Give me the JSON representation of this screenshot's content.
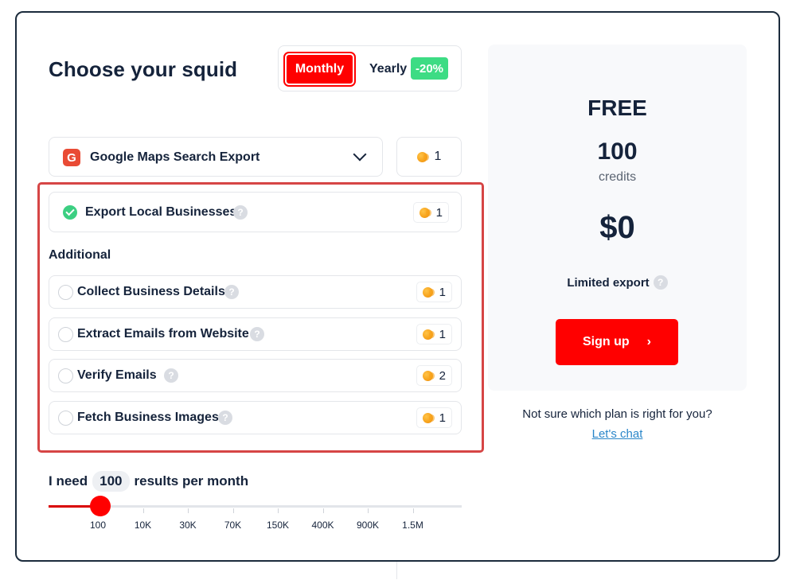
{
  "title": "Choose your squid",
  "billing": {
    "monthly_label": "Monthly",
    "yearly_label": "Yearly",
    "discount": "-20%",
    "selected": "Monthly"
  },
  "service": {
    "icon_letter": "G",
    "label": "Google Maps Search Export",
    "credits": "1"
  },
  "main_option": {
    "label": "Export Local Businesses",
    "credits": "1",
    "checked": true
  },
  "additional_title": "Additional",
  "addons": [
    {
      "label": "Collect Business Details",
      "credits": "1"
    },
    {
      "label": "Extract Emails from Website",
      "credits": "1"
    },
    {
      "label": "Verify Emails",
      "credits": "2"
    },
    {
      "label": "Fetch Business Images",
      "credits": "1"
    }
  ],
  "results": {
    "prefix": "I need",
    "count": "100",
    "suffix": "results per month"
  },
  "slider": {
    "ticks": [
      "100",
      "10K",
      "30K",
      "70K",
      "150K",
      "400K",
      "900K",
      "1.5M"
    ],
    "selected_index": 0
  },
  "plan": {
    "name": "FREE",
    "credits": "100",
    "credits_unit": "credits",
    "price": "$0",
    "note": "Limited export",
    "signup_label": "Sign up",
    "signup_arrow": "›"
  },
  "help": {
    "question": "Not sure which plan is right for you?",
    "link": "Let's chat"
  },
  "colors": {
    "accent": "#ff0000",
    "dark": "#15233b",
    "success": "#3ccf82",
    "discount": "#3ddc84",
    "highlight": "#d64545"
  },
  "icons": {
    "help": "question-icon",
    "coin": "coin-icon",
    "check": "check-circle-icon",
    "dropdown": "chevron-down-icon"
  }
}
